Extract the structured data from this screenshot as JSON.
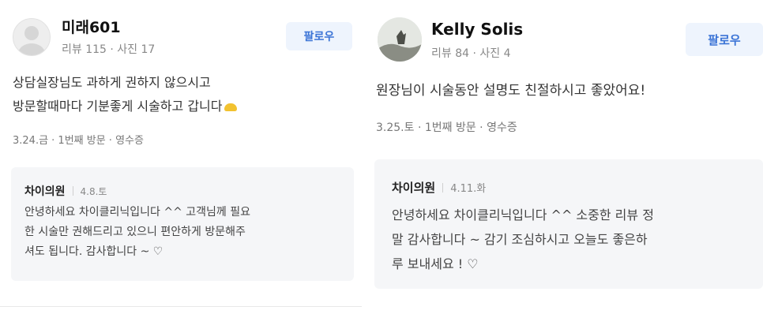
{
  "reviews": [
    {
      "user_name": "미래601",
      "review_count": "리뷰 115",
      "photo_count": "사진 17",
      "follow_label": "팔로우",
      "text_line1": "상담실장님도 과하게 권하지 않으시고",
      "text_line2": "방문할때마다 기분좋게 시술하고 갑니다",
      "visit_meta": "3.24.금 · 1번째 방문 · 영수증",
      "reply": {
        "name": "차이의원",
        "date": "4.8.토",
        "line1": "안녕하세요 차이클리닉입니다 ^^ 고객님께 필요",
        "line2": "한 시술만 권해드리고 있으니 편안하게 방문해주",
        "line3": "셔도 됩니다. 감사합니다 ~ ♡"
      }
    },
    {
      "user_name": "Kelly Solis",
      "review_count": "리뷰 84",
      "photo_count": "사진 4",
      "follow_label": "팔로우",
      "text_line1": "원장님이 시술동안 설명도 친절하시고 좋았어요!",
      "visit_meta": "3.25.토 · 1번째 방문 · 영수증",
      "reply": {
        "name": "차이의원",
        "date": "4.11.화",
        "line1": "안녕하세요 차이클리닉입니다 ^^ 소중한 리뷰 정",
        "line2": "말 감사합니다 ~ 감기 조심하시고 오늘도 좋은하",
        "line3": "루 보내세요 ! ♡"
      }
    }
  ],
  "meta_separator": "·"
}
